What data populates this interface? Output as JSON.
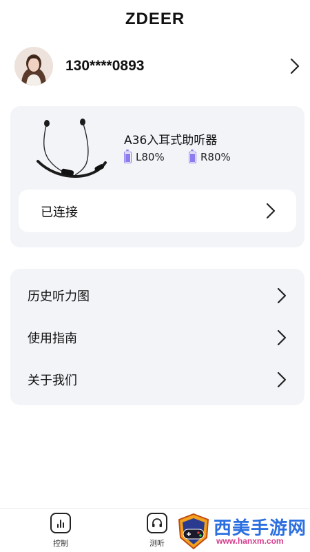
{
  "app_title": "ZDEER",
  "profile": {
    "phone": "130****0893",
    "avatar": "user-avatar-photo"
  },
  "device": {
    "name": "A36入耳式助听器",
    "battery_left_label": "L80%",
    "battery_right_label": "R80%",
    "battery_left_level": 0.8,
    "battery_right_level": 0.8,
    "status": "已连接",
    "battery_color": "#8c7cf0"
  },
  "menu": {
    "items": [
      {
        "label": "历史听力图"
      },
      {
        "label": "使用指南"
      },
      {
        "label": "关于我们"
      }
    ]
  },
  "bottom_nav": {
    "tabs": [
      {
        "label": "控制",
        "icon": "equalizer-icon"
      },
      {
        "label": "测听",
        "icon": "headphones-icon"
      }
    ]
  },
  "watermark": {
    "title": "西美手游网",
    "url": "www.hanxm.com"
  }
}
